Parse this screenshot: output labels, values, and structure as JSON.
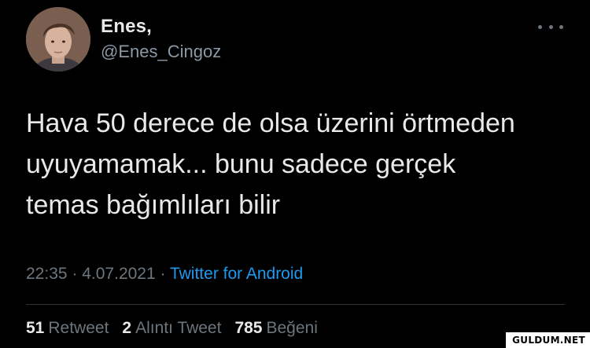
{
  "author": {
    "display_name": "Enes,",
    "handle": "@Enes_Cingoz"
  },
  "tweet": {
    "text_lines": [
      "Hava 50 derece de olsa üzerini örtmeden",
      "uyuyamamak... bunu sadece gerçek",
      "temas bağımlıları bilir"
    ],
    "time": "22:35",
    "date": "4.07.2021",
    "separator": "·",
    "source": "Twitter for Android"
  },
  "stats": {
    "retweets": {
      "count": "51",
      "label": "Retweet"
    },
    "quotes": {
      "count": "2",
      "label": "Alıntı Tweet"
    },
    "likes": {
      "count": "785",
      "label": "Beğeni"
    }
  },
  "watermark": "GULDUM.NET",
  "colors": {
    "background": "#000000",
    "primary_text": "#e7e9ea",
    "secondary_text": "#6e767d",
    "link": "#1d9bf0"
  },
  "icons": {
    "more": "more-horizontal-icon",
    "avatar": "profile-photo"
  }
}
